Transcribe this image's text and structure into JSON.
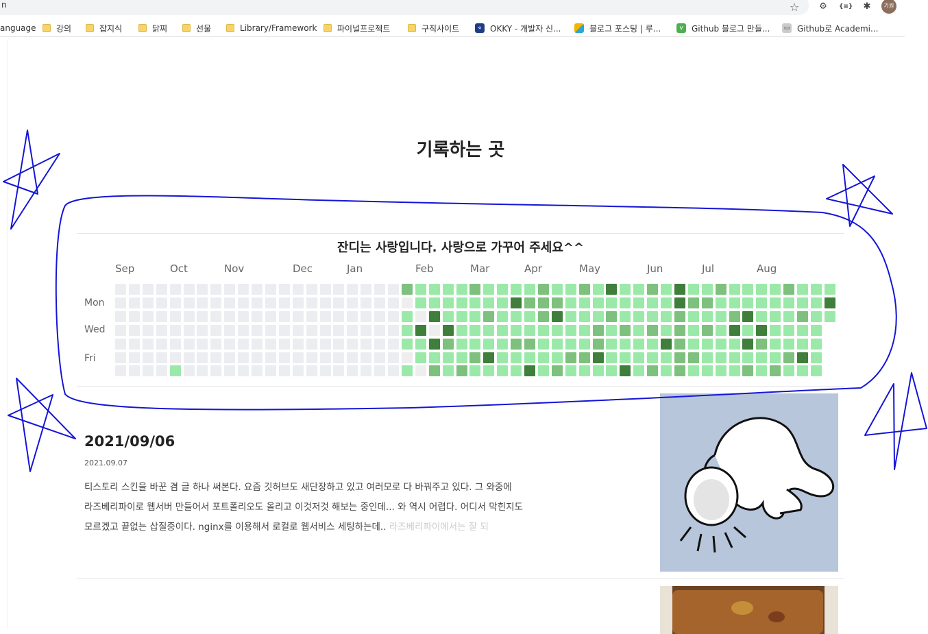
{
  "browser": {
    "address_fragment": "n",
    "avatar_label": "기원",
    "bookmarks": [
      {
        "label": "anguage",
        "kind": "partial"
      },
      {
        "label": "강의",
        "kind": "folder"
      },
      {
        "label": "잡지식",
        "kind": "folder"
      },
      {
        "label": "닭찌",
        "kind": "folder"
      },
      {
        "label": "선물",
        "kind": "folder"
      },
      {
        "label": "Library/Framework",
        "kind": "folder"
      },
      {
        "label": "파이널프로젝트",
        "kind": "folder"
      },
      {
        "label": "구직사이트",
        "kind": "folder"
      },
      {
        "label": "OKKY - 개발자 신...",
        "kind": "site"
      },
      {
        "label": "블로그 포스팅 | 루...",
        "kind": "site"
      },
      {
        "label": "Github 블로그 만들...",
        "kind": "site"
      },
      {
        "label": "Github로 Academi...",
        "kind": "site"
      }
    ]
  },
  "page": {
    "title": "기록하는 곳"
  },
  "grass": {
    "title": "잔디는 사랑입니다. 사랑으로 가꾸어 주세요^^",
    "months": [
      "Sep",
      "Oct",
      "Nov",
      "Dec",
      "Jan",
      "Feb",
      "Mar",
      "Apr",
      "May",
      "Jun",
      "Jul",
      "Aug"
    ],
    "days": [
      "Mon",
      "Wed",
      "Fri"
    ],
    "colors": [
      "#ebedf0",
      "#9be9a8",
      "#7ec07d",
      "#3f7e3b",
      "#eeeeee"
    ]
  },
  "posts": [
    {
      "title": "2021/09/06",
      "date": "2021.09.07",
      "excerpt_line1": "티스토리 스킨을 바꾼 겸 글 하나 써본다. 요즘 깃허브도 새단장하고 있고 여러모로 다 바꿔주고 있다. 그 와중에",
      "excerpt_line2": "라즈베리파이로 웹서버 만들어서 포트폴리오도 올리고 이것저것 해보는 중인데... 와 역시 어렵다. 어디서 막힌지도",
      "excerpt_line3": "모르겠고 끝없는 삽질중이다. nginx를 이용해서 로컬로 웹서비스 세팅하는데..",
      "excerpt_faded": "라즈베리파이에서는 잘 되"
    }
  ]
}
